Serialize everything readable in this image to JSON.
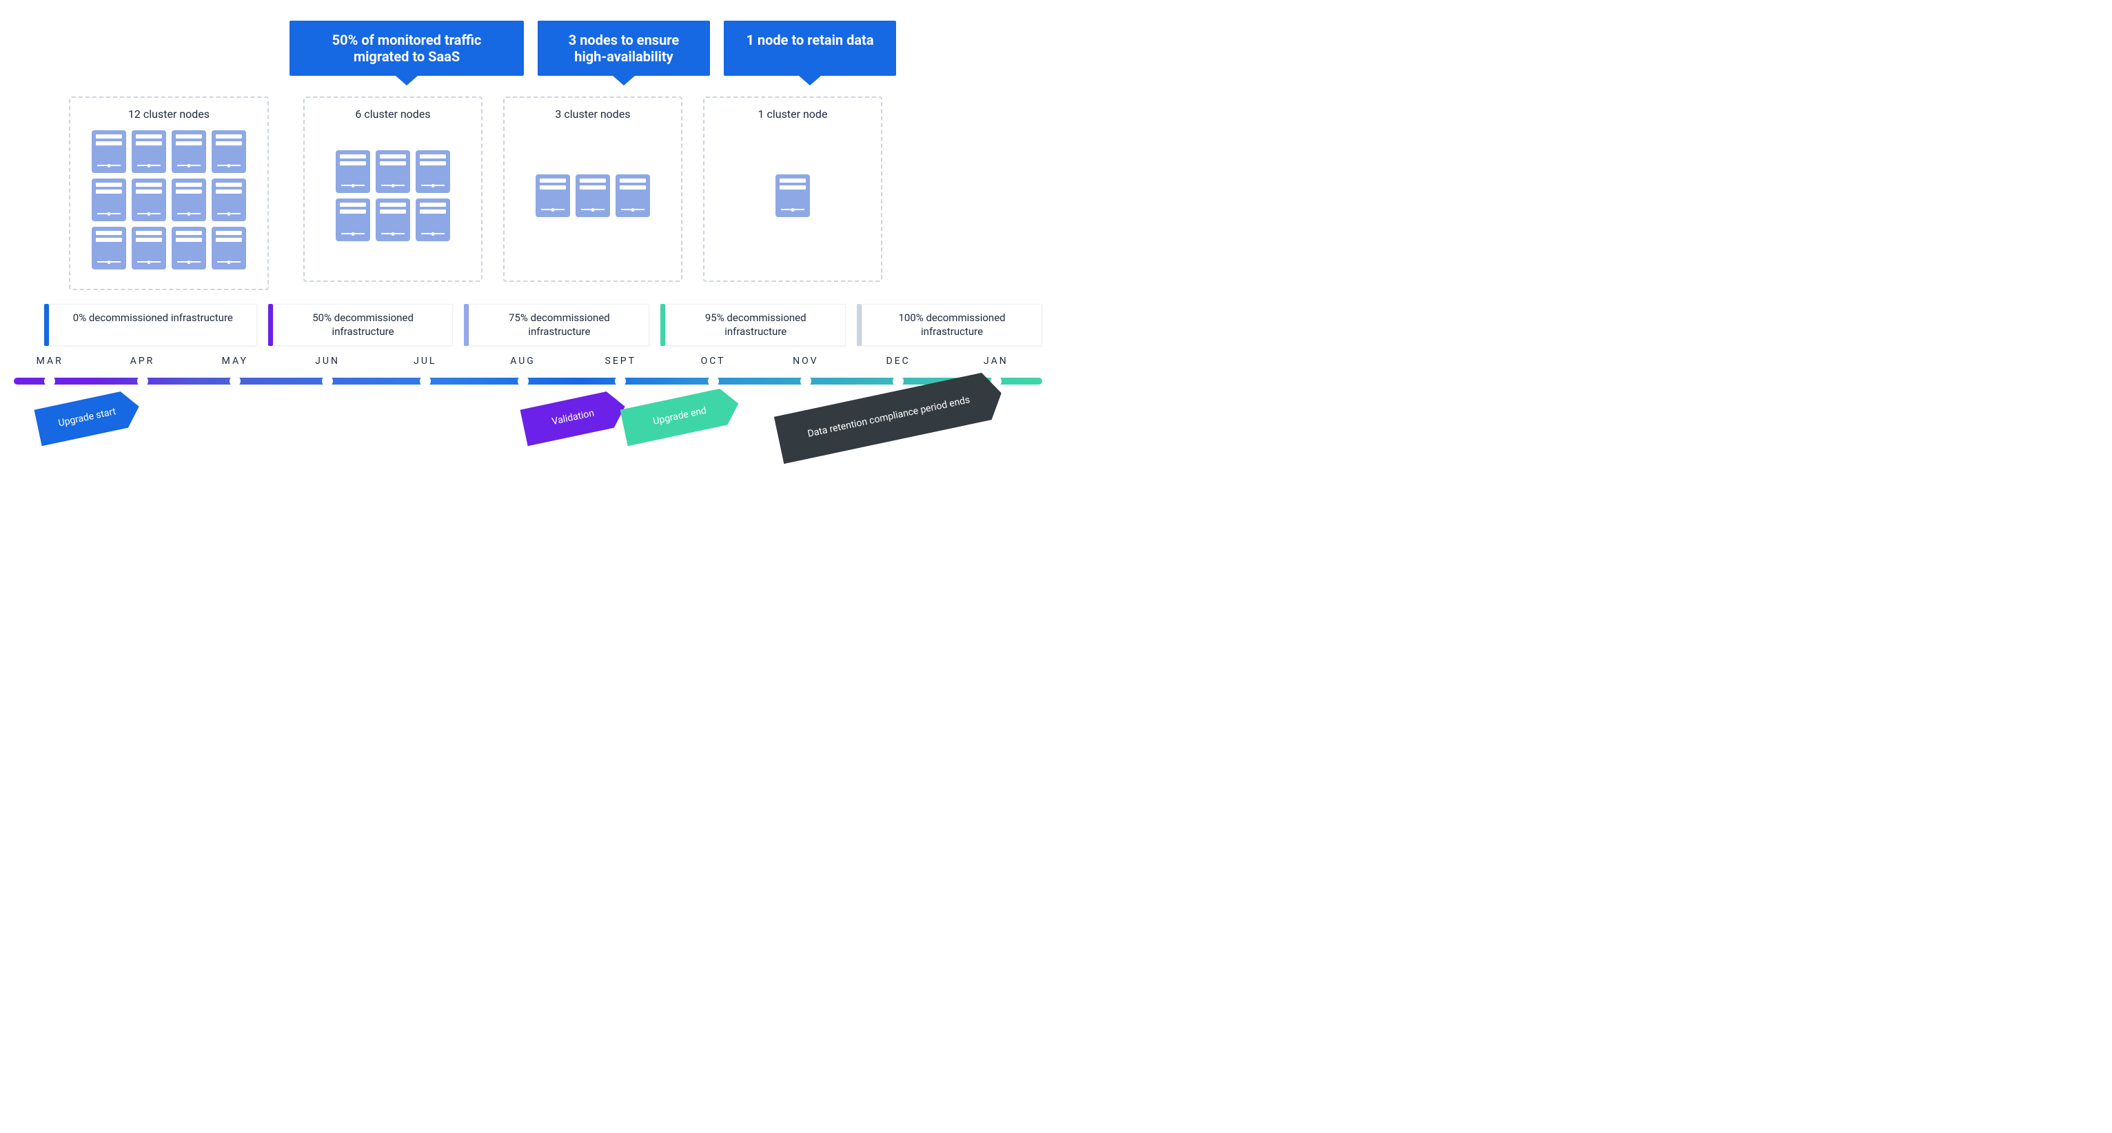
{
  "callouts": [
    "50% of monitored traffic migrated to SaaS",
    "3 nodes to ensure high-availability",
    "1 node to retain data"
  ],
  "stages": [
    {
      "title": "12 cluster nodes",
      "rows": [
        4,
        4,
        4
      ]
    },
    {
      "title": "6 cluster nodes",
      "rows": [
        3,
        3
      ]
    },
    {
      "title": "3 cluster nodes",
      "rows": [
        3
      ]
    },
    {
      "title": "1 cluster node",
      "rows": [
        1
      ]
    }
  ],
  "bars": [
    "0% decommissioned infrastructure",
    "50% decommissioned infrastructure",
    "75% decommissioned infrastructure",
    "95% decommissioned infrastructure",
    "100% decommissioned infrastructure"
  ],
  "months": [
    "MAR",
    "APR",
    "MAY",
    "JUN",
    "JUL",
    "AUG",
    "SEPT",
    "OCT",
    "NOV",
    "DEC",
    "JAN"
  ],
  "month_positions_pct": [
    3.5,
    12.5,
    21.5,
    30.5,
    40,
    49.5,
    59,
    68,
    77,
    86,
    95.5
  ],
  "flags": {
    "upgrade_start": "Upgrade start",
    "validation": "Validation",
    "upgrade_end": "Upgrade end",
    "retention_end": "Data retention compliance period ends"
  },
  "chart_data": {
    "type": "table",
    "title": "Cluster downsizing & infrastructure decommissioning timeline",
    "series": [
      {
        "name": "cluster_nodes_remaining",
        "categories": [
          "MAR",
          "JUN",
          "AUG",
          "OCT"
        ],
        "values": [
          12,
          6,
          3,
          1
        ]
      },
      {
        "name": "decommissioned_pct",
        "categories": [
          "MAR",
          "JUN",
          "AUG",
          "OCT",
          "DEC"
        ],
        "values": [
          0,
          50,
          75,
          95,
          100
        ]
      }
    ],
    "milestones": [
      {
        "month": "MAR",
        "label": "Upgrade start"
      },
      {
        "month": "SEPT",
        "label": "Validation"
      },
      {
        "month": "OCT",
        "label": "Upgrade end"
      },
      {
        "month": "JAN",
        "label": "Data retention compliance period ends"
      }
    ],
    "annotations": [
      {
        "month": "JUN",
        "text": "50% of monitored traffic migrated to SaaS"
      },
      {
        "month": "AUG",
        "text": "3 nodes to ensure high-availability"
      },
      {
        "month": "OCT",
        "text": "1 node to retain data"
      }
    ]
  }
}
